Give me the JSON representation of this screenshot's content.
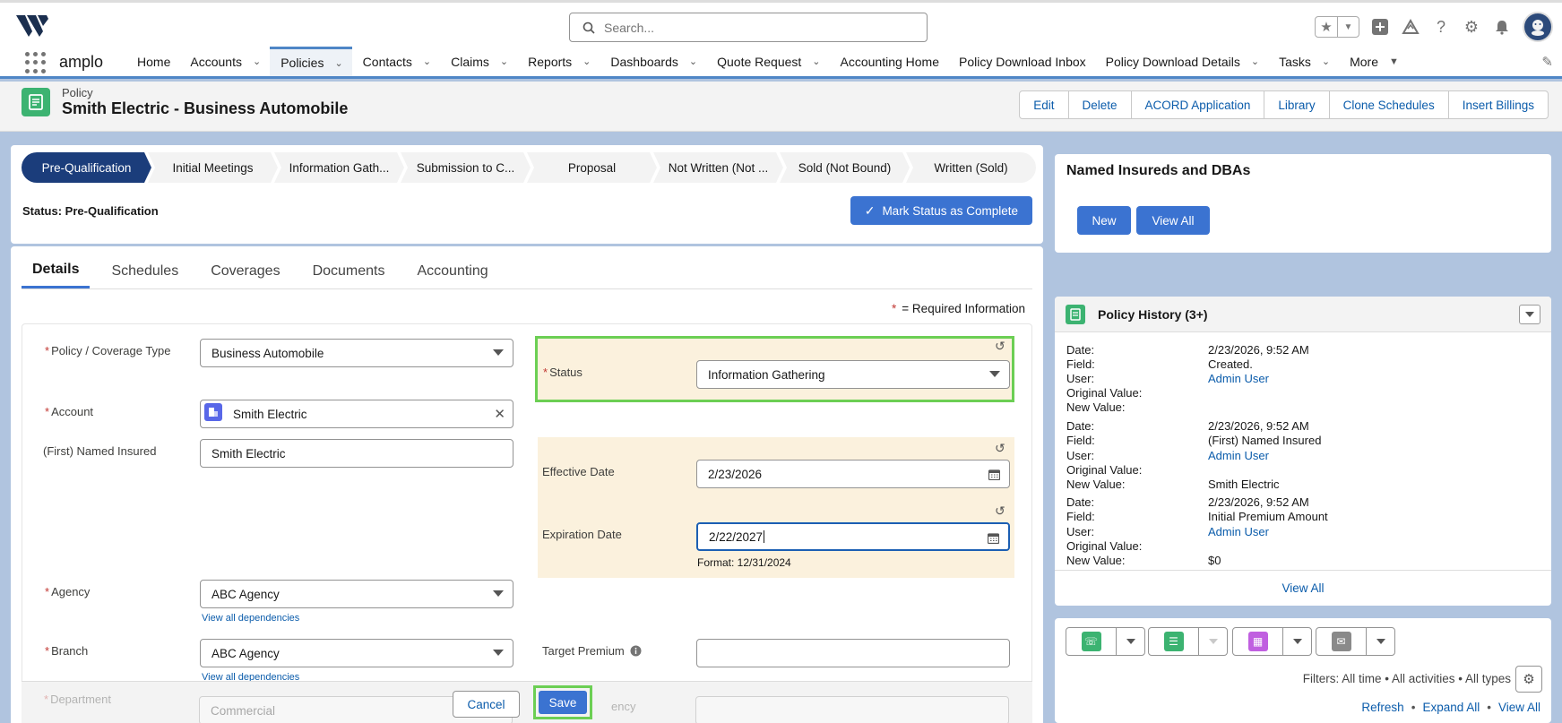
{
  "header": {
    "search_placeholder": "Search...",
    "app_name": "amplo"
  },
  "nav": {
    "items": [
      {
        "label": "Home",
        "chevron": false
      },
      {
        "label": "Accounts",
        "chevron": true
      },
      {
        "label": "Policies",
        "chevron": true,
        "active": true
      },
      {
        "label": "Contacts",
        "chevron": true
      },
      {
        "label": "Claims",
        "chevron": true
      },
      {
        "label": "Reports",
        "chevron": true
      },
      {
        "label": "Dashboards",
        "chevron": true
      },
      {
        "label": "Quote Request",
        "chevron": true
      },
      {
        "label": "Accounting Home",
        "chevron": false
      },
      {
        "label": "Policy Download Inbox",
        "chevron": false
      },
      {
        "label": "Policy Download Details",
        "chevron": true
      },
      {
        "label": "Tasks",
        "chevron": true
      },
      {
        "label": "More",
        "chevron": true
      }
    ]
  },
  "record": {
    "type": "Policy",
    "title": "Smith Electric - Business Automobile",
    "actions": [
      "Edit",
      "Delete",
      "ACORD Application",
      "Library",
      "Clone Schedules",
      "Insert Billings"
    ]
  },
  "path": {
    "steps": [
      "Pre-Qualification",
      "Initial Meetings",
      "Information Gath...",
      "Submission to C...",
      "Proposal",
      "Not Written (Not ...",
      "Sold (Not Bound)",
      "Written (Sold)"
    ],
    "current_index": 0,
    "status_text": "Status: Pre-Qualification",
    "mark_complete_label": "Mark Status as Complete"
  },
  "tabs": [
    "Details",
    "Schedules",
    "Coverages",
    "Documents",
    "Accounting"
  ],
  "form": {
    "required_note": "= Required Information",
    "required_star": "*",
    "policy_type": {
      "label": "Policy / Coverage Type",
      "value": "Business Automobile"
    },
    "account": {
      "label": "Account",
      "value": "Smith Electric"
    },
    "named_insured": {
      "label": "(First) Named Insured",
      "value": "Smith Electric"
    },
    "status": {
      "label": "Status",
      "value": "Information Gathering"
    },
    "effective_date": {
      "label": "Effective Date",
      "value": "2/23/2026"
    },
    "expiration_date": {
      "label": "Expiration Date",
      "value": "2/22/2027",
      "format_hint": "Format: 12/31/2024"
    },
    "agency": {
      "label": "Agency",
      "value": "ABC Agency",
      "dep_link": "View all dependencies"
    },
    "branch": {
      "label": "Branch",
      "value": "ABC Agency",
      "dep_link": "View all dependencies"
    },
    "target_premium": {
      "label": "Target Premium",
      "value": ""
    },
    "department": {
      "label": "Department",
      "value": "Commercial"
    },
    "faded_label": "ency",
    "cancel_label": "Cancel",
    "save_label": "Save"
  },
  "named_insureds": {
    "title": "Named Insureds and DBAs",
    "new_label": "New",
    "view_all_label": "View All"
  },
  "history": {
    "title": "Policy History (3+)",
    "labels": {
      "date": "Date:",
      "field": "Field:",
      "user": "User:",
      "original": "Original Value:",
      "new": "New Value:"
    },
    "entries": [
      {
        "date": "2/23/2026, 9:52 AM",
        "field": "Created.",
        "user": "Admin User",
        "original": "",
        "new": ""
      },
      {
        "date": "2/23/2026, 9:52 AM",
        "field": "(First) Named Insured",
        "user": "Admin User",
        "original": "",
        "new": "Smith Electric"
      },
      {
        "date": "2/23/2026, 9:52 AM",
        "field": "Initial Premium Amount",
        "user": "Admin User",
        "original": "",
        "new": "$0"
      }
    ],
    "view_all_label": "View All"
  },
  "activity": {
    "filters": "Filters: All time • All activities • All types",
    "refresh": "Refresh",
    "expand_all": "Expand All",
    "view_all": "View All",
    "separator": "•"
  },
  "colors": {
    "brand_blue": "#3b73d1",
    "path_current": "#1b3d7b",
    "highlight_green": "#6ccf54",
    "tan_section": "#fbf1dd",
    "record_icon": "#3cb371"
  }
}
